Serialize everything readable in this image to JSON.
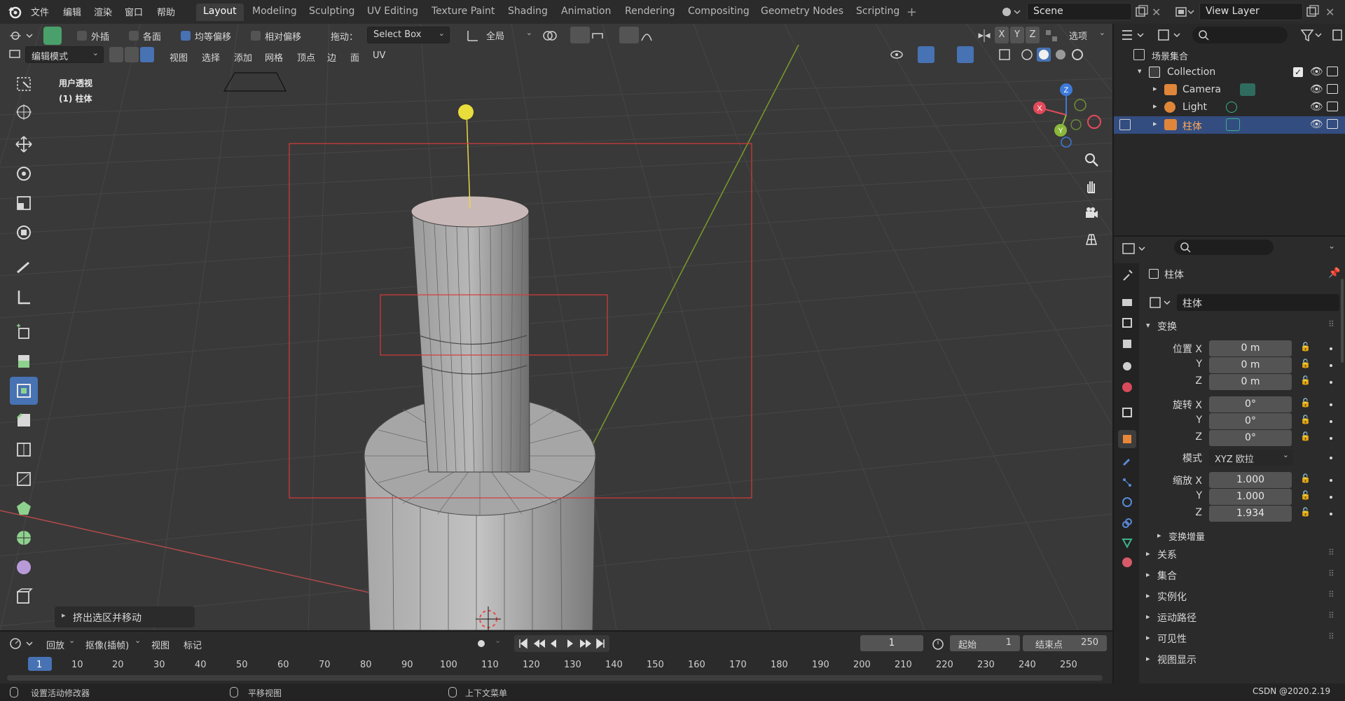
{
  "menubar": {
    "items": [
      "文件",
      "编辑",
      "渲染",
      "窗口",
      "帮助"
    ]
  },
  "workspaces": {
    "tabs": [
      "Layout",
      "Modeling",
      "Sculpting",
      "UV Editing",
      "Texture Paint",
      "Shading",
      "Animation",
      "Rendering",
      "Compositing",
      "Geometry Nodes",
      "Scripting"
    ],
    "active": "Layout"
  },
  "scene": {
    "name": "Scene",
    "view_layer": "View Layer"
  },
  "viewport_header": {
    "opt_appearance": "外插",
    "opt_backface": "各面",
    "opt_even": "均等偏移",
    "opt_relative": "相对偏移",
    "drag_label": "拖动：",
    "drag_value": "Select Box",
    "orientation": "全局",
    "options": "选项",
    "axis_x": "X",
    "axis_y": "Y",
    "axis_z": "Z"
  },
  "viewport_menu": {
    "mode": "编辑模式",
    "items": [
      "视图",
      "选择",
      "添加",
      "网格",
      "顶点",
      "边",
      "面",
      "UV"
    ]
  },
  "viewport_info": {
    "view_name": "用户透视",
    "object": "(1) 柱体"
  },
  "gizmo": {
    "x": "X",
    "y": "Y",
    "z": "Z"
  },
  "last_op": "挤出选区并移动",
  "timeline": {
    "playback": "回放",
    "keying": "抠像(插帧)",
    "view": "视图",
    "marker": "标记",
    "current_frame": "1",
    "start_label": "起始",
    "start": "1",
    "end_label": "结束点",
    "end": "250",
    "ticks": [
      "1",
      "10",
      "20",
      "30",
      "40",
      "50",
      "60",
      "70",
      "80",
      "90",
      "100",
      "110",
      "120",
      "130",
      "140",
      "150",
      "160",
      "170",
      "180",
      "190",
      "200",
      "210",
      "220",
      "230",
      "240",
      "250"
    ]
  },
  "statusbar": {
    "left": "设置活动修改器",
    "middle": "平移视图",
    "right": "上下文菜单",
    "watermark": "CSDN @2020.2.19"
  },
  "outliner": {
    "root": "场景集合",
    "collection": "Collection",
    "items": [
      {
        "name": "Camera",
        "icon": "camera-icon"
      },
      {
        "name": "Light",
        "icon": "light-icon"
      },
      {
        "name": "柱体",
        "icon": "mesh-icon"
      }
    ]
  },
  "properties": {
    "object_title": "柱体",
    "object_name": "柱体",
    "transform_label": "变换",
    "location": {
      "label": "位置 X",
      "x": "0 m",
      "y": "0 m",
      "z": "0 m"
    },
    "rotation": {
      "label": "旋转 X",
      "x": "0°",
      "y": "0°",
      "z": "0°"
    },
    "mode_label": "模式",
    "mode_value": "XYZ 欧拉",
    "scale": {
      "label": "缩放 X",
      "x": "1.000",
      "y": "1.000",
      "z": "1.934"
    },
    "axis_y": "Y",
    "axis_z": "Z",
    "delta": "变换增量",
    "sections": [
      "关系",
      "集合",
      "实例化",
      "运动路径",
      "可见性",
      "视图显示"
    ]
  },
  "colors": {
    "accent": "#4772b3",
    "selected_row": "#334d80",
    "x_axis": "#e44a5a",
    "y_axis": "#8ab73a",
    "z_axis": "#3e7ad9",
    "bg_viewport": "#393939"
  }
}
